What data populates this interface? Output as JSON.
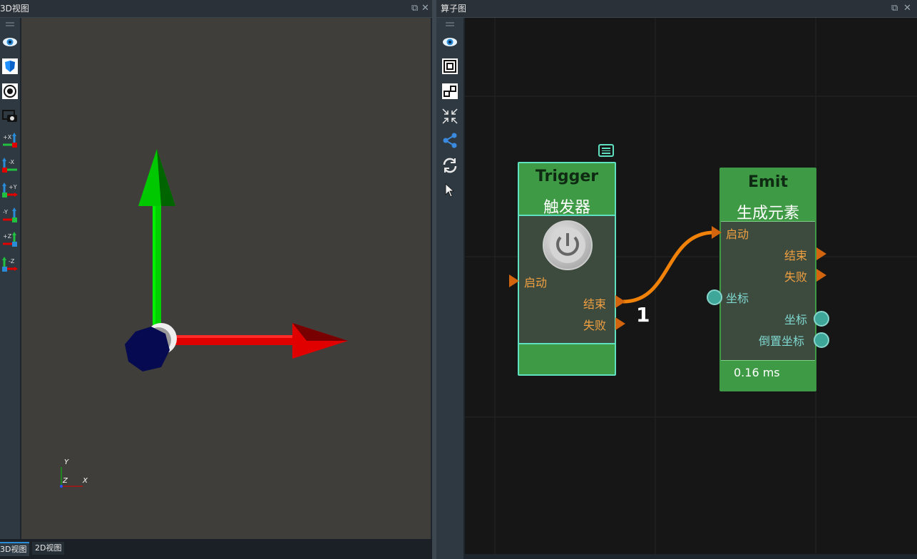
{
  "left_panel": {
    "title": "3D视图",
    "axis_labels": {
      "y": "Y",
      "z": "Z",
      "x": "X"
    }
  },
  "right_panel": {
    "title": "算子图"
  },
  "toolbar_3d": [
    {
      "icon": "eye-icon"
    },
    {
      "icon": "cube-icon"
    },
    {
      "icon": "target-icon"
    },
    {
      "icon": "camera-icon"
    },
    {
      "icon": "view-plus-x-icon",
      "label": "+X"
    },
    {
      "icon": "view-minus-x-icon",
      "label": "-X"
    },
    {
      "icon": "view-plus-y-icon",
      "label": "+Y"
    },
    {
      "icon": "view-minus-y-icon",
      "label": "-Y"
    },
    {
      "icon": "view-plus-z-icon",
      "label": "+Z"
    },
    {
      "icon": "view-minus-z-icon",
      "label": "-Z"
    }
  ],
  "toolbar_graph": [
    {
      "icon": "eye-icon"
    },
    {
      "icon": "fit-view-icon"
    },
    {
      "icon": "node-layout-icon"
    },
    {
      "icon": "collapse-icon"
    },
    {
      "icon": "share-icon"
    },
    {
      "icon": "refresh-icon"
    },
    {
      "icon": "pointer-icon"
    }
  ],
  "tabs": [
    "3D视图",
    "2D视图"
  ],
  "nodes": {
    "trigger": {
      "title": "Trigger",
      "subtitle": "触发器",
      "inputs": [
        "启动"
      ],
      "outputs": [
        "结束",
        "失败"
      ]
    },
    "emit": {
      "title": "Emit",
      "subtitle": "生成元素",
      "inputs": [
        "启动",
        "坐标"
      ],
      "outputs": [
        "结束",
        "失败",
        "坐标",
        "倒置坐标"
      ],
      "timing": "0.16 ms"
    }
  },
  "connection_label": "1",
  "colors": {
    "node_green": "#3f9a45",
    "node_border_selected": "#5fe0c0",
    "port_orange": "#d4650f",
    "wire_orange": "#f0820a",
    "port_teal": "#3fa79a",
    "axis_red": "#e00000",
    "axis_green": "#00d000",
    "origin_navy": "#060a50"
  }
}
